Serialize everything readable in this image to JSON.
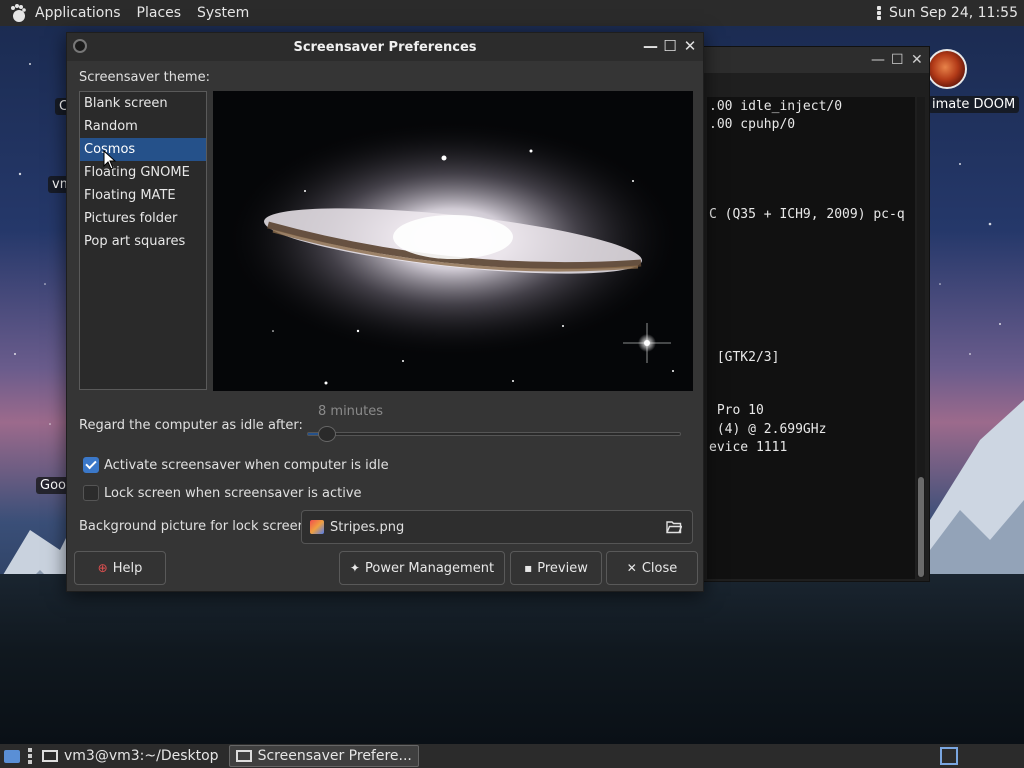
{
  "top_panel": {
    "menu": [
      "Applications",
      "Places",
      "System"
    ],
    "clock": "Sun Sep 24, 11:55"
  },
  "desktop": {
    "labels": {
      "left_c": "C",
      "vm": "vm",
      "goo": "Goo",
      "doom": "imate DOOM"
    }
  },
  "terminal": {
    "lines": [
      ".00 idle_inject/0",
      ".00 cpuhp/0",
      "C (Q35 + ICH9, 2009) pc-q",
      " [GTK2/3]",
      " Pro 10",
      " (4) @ 2.699GHz",
      "evice 1111"
    ]
  },
  "dialog": {
    "title": "Screensaver Preferences",
    "theme_label": "Screensaver theme:",
    "themes": [
      "Blank screen",
      "Random",
      "Cosmos",
      "Floating GNOME",
      "Floating MATE",
      "Pictures folder",
      "Pop art squares"
    ],
    "selected_theme": "Cosmos",
    "idle_label": "Regard the computer as idle after:",
    "idle_value": "8 minutes",
    "idle_fraction": 0.04,
    "activate_label": "Activate screensaver when computer is idle",
    "activate_checked": true,
    "lock_label": "Lock screen when screensaver is active",
    "lock_checked": false,
    "bg_label": "Background picture for lock screen:",
    "bg_file": "Stripes.png",
    "buttons": {
      "help": "Help",
      "power": "Power Management",
      "preview": "Preview",
      "close": "Close"
    }
  },
  "taskbar": {
    "tasks": [
      "vm3@vm3:~/Desktop",
      "Screensaver Prefere..."
    ]
  }
}
